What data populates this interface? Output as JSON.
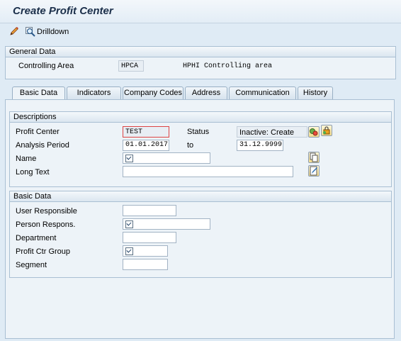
{
  "window": {
    "title": "Create Profit Center"
  },
  "toolbar": {
    "drilldown_label": "Drilldown"
  },
  "general_data": {
    "header": "General Data",
    "controlling_area_label": "Controlling Area",
    "controlling_area_value": "HPCA",
    "controlling_area_desc": "HPHI Controlling area"
  },
  "tabs": [
    {
      "label": "Basic Data",
      "active": true
    },
    {
      "label": "Indicators",
      "active": false
    },
    {
      "label": "Company Codes",
      "active": false
    },
    {
      "label": "Address",
      "active": false
    },
    {
      "label": "Communication",
      "active": false
    },
    {
      "label": "History",
      "active": false
    }
  ],
  "descriptions": {
    "header": "Descriptions",
    "profit_center_label": "Profit Center",
    "profit_center_value": "TEST",
    "status_label": "Status",
    "status_value": "Inactive: Create",
    "analysis_period_label": "Analysis Period",
    "analysis_from": "01.01.2017",
    "to_label": "to",
    "analysis_to": "31.12.9999",
    "name_label": "Name",
    "name_value": "",
    "long_text_label": "Long Text",
    "long_text_value": ""
  },
  "basic_data": {
    "header": "Basic Data",
    "user_responsible_label": "User Responsible",
    "user_responsible_value": "",
    "person_respons_label": "Person Respons.",
    "person_respons_value": "",
    "department_label": "Department",
    "department_value": "",
    "profit_ctr_group_label": "Profit Ctr Group",
    "profit_ctr_group_value": "",
    "segment_label": "Segment",
    "segment_value": ""
  },
  "icons": {
    "edit": "pencil-icon",
    "drilldown": "magnifier-icon",
    "activate": "activate-icon",
    "lock": "lock-icon",
    "copy": "copy-document-icon",
    "edit_text": "edit-text-icon"
  }
}
